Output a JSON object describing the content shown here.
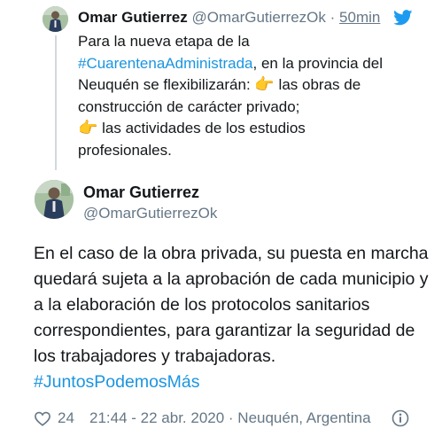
{
  "quoted_tweet": {
    "name": "Omar Gutierrez",
    "handle": "@OmarGutierrezOk",
    "separator": "·",
    "time": "50min",
    "text_line1": "Para la nueva etapa de la",
    "hashtag": "#CuarentenaAdministrada",
    "text_line2_rest": ", en la provincia del",
    "text_line3": "Neuquén se flexibilizarán:",
    "text_line3_rest": " las obras de",
    "text_line4": "construcción de carácter privado;",
    "text_line5_rest": " las actividades de los estudios",
    "text_line6": "profesionales.",
    "pointing_icon": "👉"
  },
  "main_tweet": {
    "name": "Omar Gutierrez",
    "handle": "@OmarGutierrezOk",
    "text": "En el caso de la obra privada, su puesta en marcha quedará sujeta a la aprobación de cada municipio y a la elaboración de los protocolos sanitarios correspondientes, para garantizar la seguridad de los trabajadores y trabajadoras.",
    "hashtag": "#JuntosPodemosMás"
  },
  "footer": {
    "like_count": "24",
    "meta": "21:44 - 22 abr. 2020 · Neuquén, Argentina"
  },
  "icons": {
    "bird": "twitter-bird-icon",
    "heart": "heart-icon",
    "info": "info-icon"
  },
  "colors": {
    "accent": "#1b95e0",
    "secondary_text": "#657786",
    "primary_text": "#14171a",
    "thread_line": "#cfd9de",
    "pointing_hand": "#f3b26b"
  }
}
